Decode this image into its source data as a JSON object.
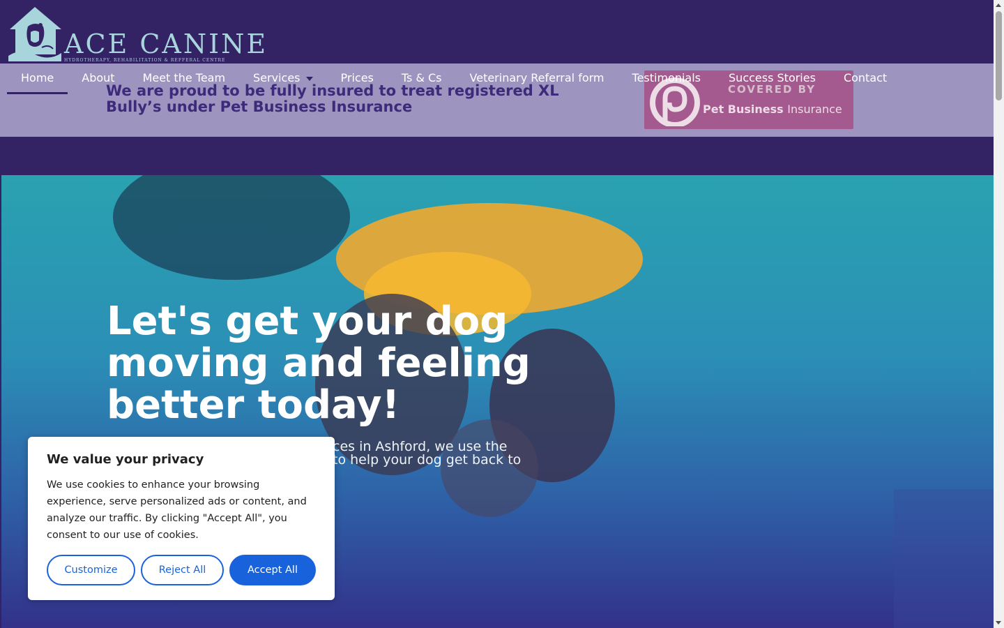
{
  "header": {
    "logo_title": "ACE CANINE",
    "logo_subtitle": "HYDROTHERAPY, REHABILITATION & REFFERAL CENTRE"
  },
  "nav": {
    "items": [
      {
        "label": "Home",
        "active": true
      },
      {
        "label": "About"
      },
      {
        "label": "Meet the Team"
      },
      {
        "label": "Services",
        "has_dropdown": true
      },
      {
        "label": "Prices"
      },
      {
        "label": "Ts & Cs"
      },
      {
        "label": "Veterinary Referral form"
      },
      {
        "label": "Testimonials"
      },
      {
        "label": "Success Stories"
      },
      {
        "label": "Contact"
      }
    ]
  },
  "banner": {
    "text": "We are proud to be fully insured to treat registered XL Bully’s under Pet Business Insurance",
    "badge_top": "COVERED BY",
    "badge_brand_bold": "Pet Business",
    "badge_brand_light": "Insurance"
  },
  "hero": {
    "title": "Let's get your dog moving and feeling better today!",
    "subtitle_visible_line1": "ces in Ashford, we use the",
    "subtitle_visible_line2": "to help your dog get back to"
  },
  "cookie": {
    "title": "We value your privacy",
    "body": "We use cookies to enhance your browsing experience, serve personalized ads or content, and analyze our traffic. By clicking \"Accept All\", you consent to our use of cookies.",
    "customize_label": "Customize",
    "reject_label": "Reject All",
    "accept_label": "Accept All"
  },
  "colors": {
    "header_bg": "#342364",
    "banner_bg": "#9d94bf",
    "banner_text": "#3d2a7a",
    "badge_bg": "#a4598f",
    "logo": "#a8d4dc",
    "cookie_accent": "#1863dc"
  }
}
